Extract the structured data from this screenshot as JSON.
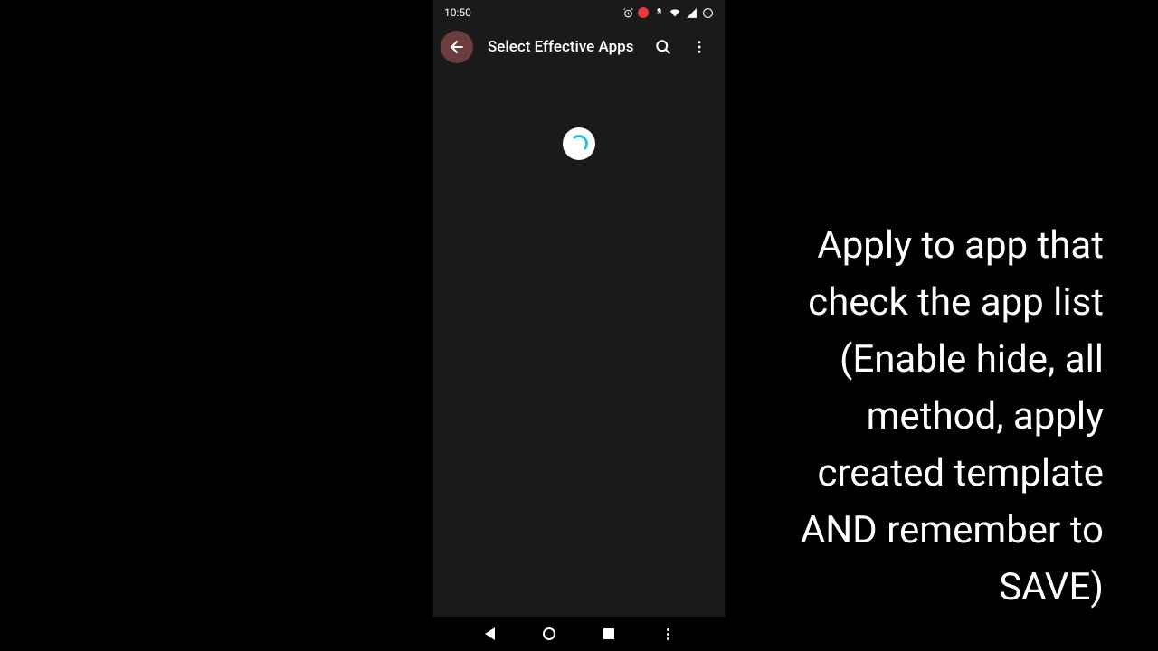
{
  "status_bar": {
    "time": "10:50"
  },
  "app_bar": {
    "title": "Select Effective Apps"
  },
  "instructions": {
    "text": "Apply to app that check the app list (Enable hide, all method, apply created template AND remember to SAVE)"
  }
}
